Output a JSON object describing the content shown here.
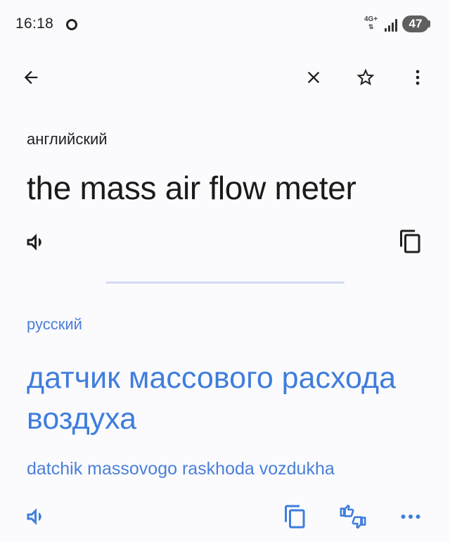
{
  "status_bar": {
    "time": "16:18",
    "network": "4G+",
    "battery": "47"
  },
  "toolbar": {
    "icons": [
      "back-arrow-icon",
      "close-icon",
      "star-icon",
      "more-vert-icon"
    ]
  },
  "source": {
    "language": "английский",
    "text": "the mass air flow meter"
  },
  "target": {
    "language": "русский",
    "text": "датчик массового расхода воздуха",
    "transliteration": "datchik massovogo raskhoda vozdukha"
  },
  "colors": {
    "accent": "#3f7ddc",
    "background": "#fbfbfe",
    "divider": "#d3dcf2"
  }
}
